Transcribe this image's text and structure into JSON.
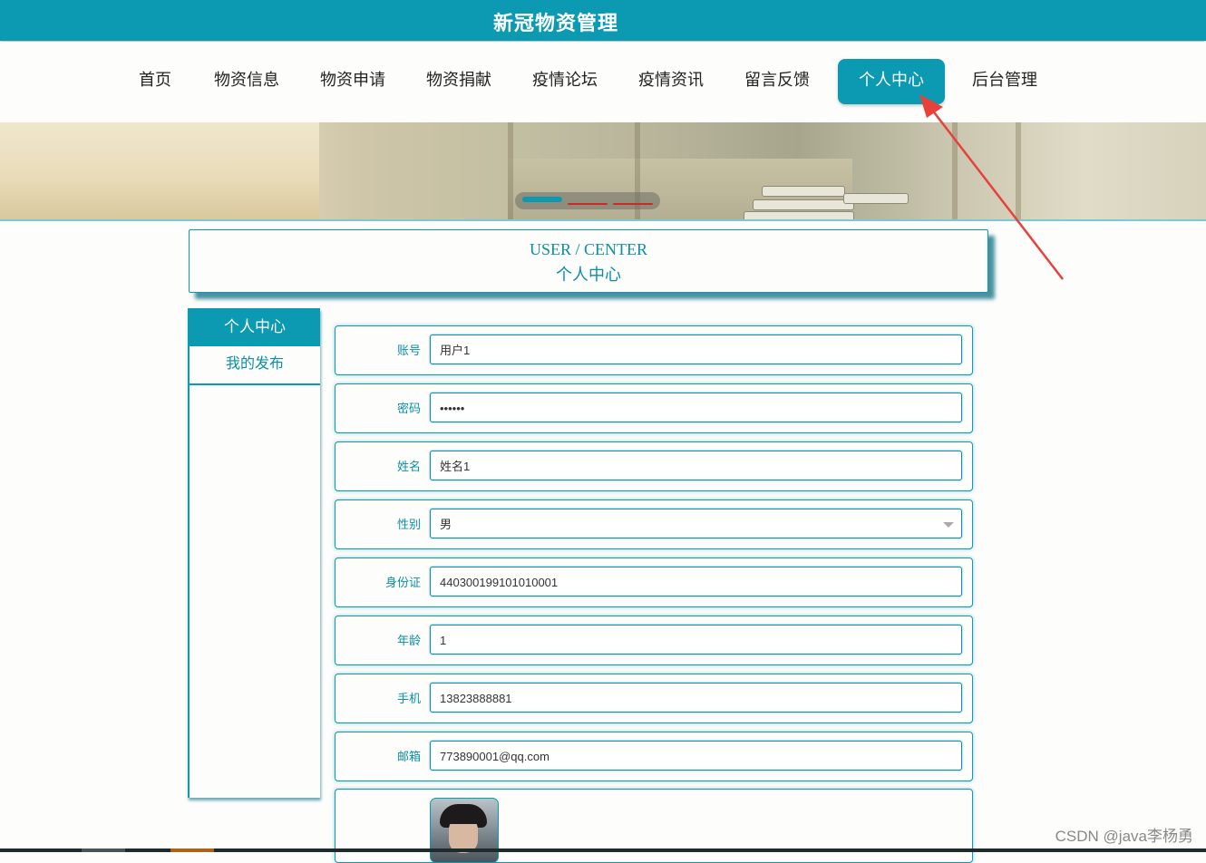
{
  "header": {
    "title": "新冠物资管理"
  },
  "nav": {
    "items": [
      {
        "label": "首页",
        "active": false
      },
      {
        "label": "物资信息",
        "active": false
      },
      {
        "label": "物资申请",
        "active": false
      },
      {
        "label": "物资捐献",
        "active": false
      },
      {
        "label": "疫情论坛",
        "active": false
      },
      {
        "label": "疫情资讯",
        "active": false
      },
      {
        "label": "留言反馈",
        "active": false
      },
      {
        "label": "个人中心",
        "active": true
      },
      {
        "label": "后台管理",
        "active": false
      }
    ]
  },
  "banner": {
    "slide_count": 3,
    "active_slide": 1
  },
  "section": {
    "title_en": "USER / CENTER",
    "title_zh": "个人中心"
  },
  "sidebar": {
    "header": "个人中心",
    "items": [
      {
        "label": "我的发布"
      }
    ]
  },
  "form": {
    "fields": [
      {
        "label": "账号",
        "value": "用户1"
      },
      {
        "label": "密码",
        "value": "••••••"
      },
      {
        "label": "姓名",
        "value": "姓名1"
      },
      {
        "label": "性别",
        "value": "男",
        "type": "select"
      },
      {
        "label": "身份证",
        "value": "440300199101010001"
      },
      {
        "label": "年龄",
        "value": "1"
      },
      {
        "label": "手机",
        "value": "13823888881"
      },
      {
        "label": "邮箱",
        "value": "773890001@qq.com"
      }
    ],
    "avatar_icon": "user-photo"
  },
  "watermark": "CSDN @java李杨勇",
  "colors": {
    "primary": "#0b9ab1",
    "text": "#0b8fa6",
    "arrow": "#e8413c"
  }
}
